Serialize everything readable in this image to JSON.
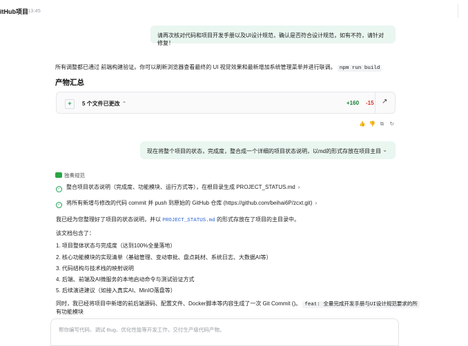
{
  "header": {
    "title": "itHub项目",
    "time": "13:45"
  },
  "msg1": {
    "text": "请再次核对代码和项目开发手册以及UI设计规范，确认是否符合设计规范，如有不符，请针对修复！"
  },
  "reply1": {
    "line": "所有调整都已通过 前端构建验证。你可以刷新浏览器查看最终的 UI 视觉效果和最新增加系统管理菜单并进行联调。",
    "cmd": "npm run build"
  },
  "artifacts": {
    "title": "产物汇总",
    "files_label": "5 个文件已更改",
    "additions": "+160",
    "deletions": "-15"
  },
  "msg2": {
    "text": "现在将整个项目的状态，完成度，整合成一个详细的项目状态说明，以md的形式存放在项目主目"
  },
  "agent": {
    "label": "独奏规范",
    "steps": [
      {
        "text": "整合项目状态说明（完成度、功能模块、运行方式等），在根目录生成 PROJECT_STATUS.md"
      },
      {
        "text": "将所有新增与修改的代码 commit 并 push 到原始的 GitHub 仓库 (https://github.com/beihai6P/zcxt.git)"
      }
    ]
  },
  "reply2": {
    "intro_a": "我已经为您整理好了项目的状态说明，并以",
    "intro_file": "PROJECT_STATUS.md",
    "intro_b": "的形式存放在了项目的主目录中。",
    "doc_includes": "该文档包含了：",
    "items": [
      "1. 项目整体状态与完成度（达到100%全量落地）",
      "2. 核心功能模块的实现清单（基础管理、变动审批、盘点耗材、系统日志、大数据AI等）",
      "3. 代码结构与技术栈的映射说明",
      "4. 后端、前端及AI微服务的本地启动命令与测试验证方式",
      "5. 后续演进建议（如接入真实AI、MinIO落盘等）"
    ],
    "closing_a": "同时，我已经将项目中新增的前后端源码、配置文件、Docker脚本等内容生成了一次 Git Commit ()。",
    "closing_code": "feat: 全量完成开发手册与UI设计规范要求的所",
    "closing_b": "有功能模块"
  },
  "composer": {
    "placeholder": "帮你编写代码、调试 Bug、优化性能等开发工作，交付生产级代码产物。"
  },
  "colors": {
    "accent_green": "#188038",
    "delete_red": "#d93025",
    "bubble_bg": "#eaf6f0"
  }
}
